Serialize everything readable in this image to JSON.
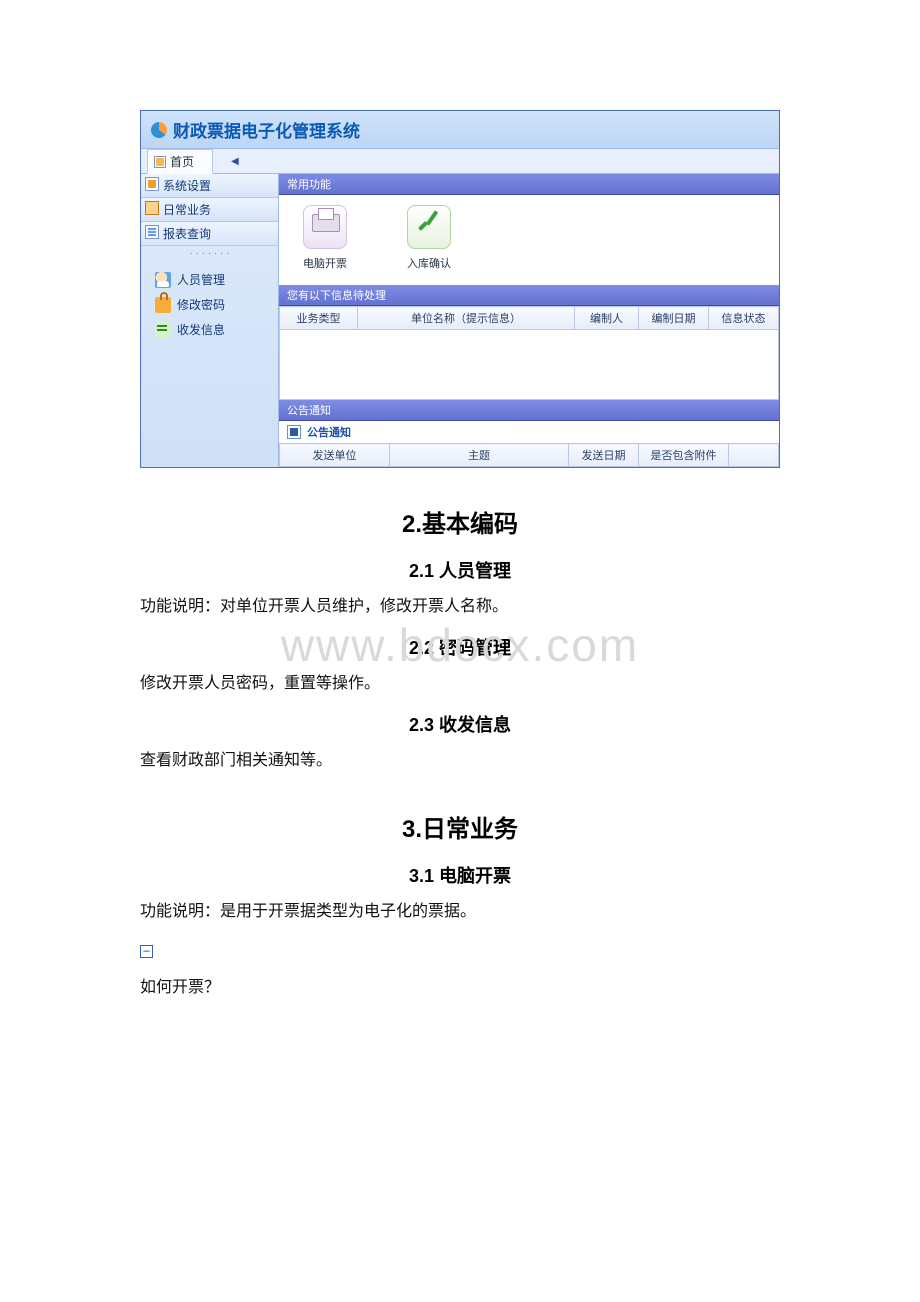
{
  "app": {
    "title": "财政票据电子化管理系统",
    "home_tab": "首页",
    "sidebar_groups": {
      "settings": "系统设置",
      "daily": "日常业务",
      "report": "报表查询"
    },
    "sidebar_items": {
      "people": "人员管理",
      "password": "修改密码",
      "message": "收发信息"
    },
    "panels": {
      "common": "常用功能",
      "pending": "您有以下信息待处理",
      "announce": "公告通知"
    },
    "shortcuts": {
      "print": "电脑开票",
      "confirm": "入库确认"
    },
    "pending_table": {
      "col_type": "业务类型",
      "col_unit": "单位名称（提示信息）",
      "col_author": "编制人",
      "col_date": "编制日期",
      "col_status": "信息状态"
    },
    "announce_link": "公告通知",
    "announce_table": {
      "col_unit": "发送单位",
      "col_subject": "主题",
      "col_date": "发送日期",
      "col_attach": "是否包含附件"
    }
  },
  "watermark": "www.bdocx.com",
  "doc": {
    "h2": "2.基本编码",
    "s21_title": "2.1 人员管理",
    "s21_body": "功能说明：对单位开票人员维护，修改开票人名称。",
    "s22_title": "2.2 密码管理",
    "s22_body": "修改开票人员密码，重置等操作。",
    "s23_title": "2.3 收发信息",
    "s23_body": "查看财政部门相关通知等。",
    "h3": "3.日常业务",
    "s31_title": "3.1 电脑开票",
    "s31_body": "功能说明：是用于开票据类型为电子化的票据。",
    "collapse_glyph": "−",
    "how_to": "如何开票？"
  }
}
